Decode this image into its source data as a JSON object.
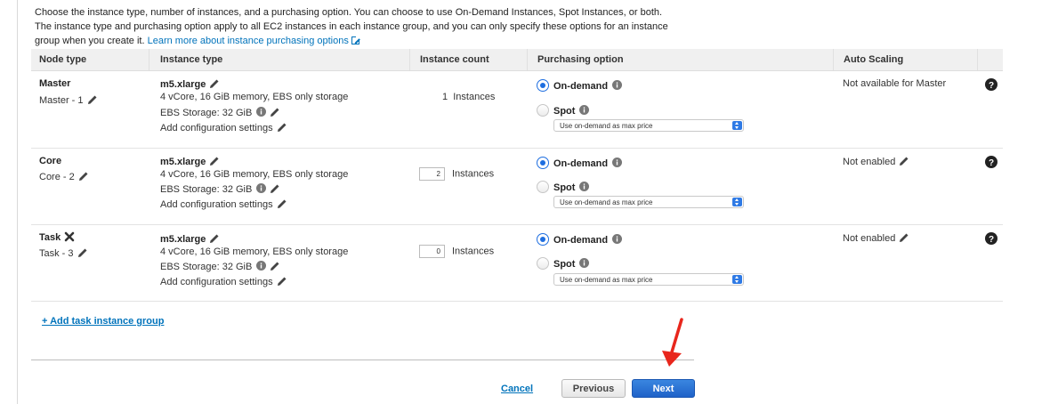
{
  "intro": {
    "line1": "Choose the instance type, number of instances, and a purchasing option. You can choose to use On-Demand Instances, Spot Instances, or both.",
    "line2": "The instance type and purchasing option apply to all EC2 instances in each instance group, and you can only specify these options for an instance",
    "line3": "group when you create it.",
    "link": "Learn more about instance purchasing options"
  },
  "table": {
    "headers": {
      "node_type": "Node type",
      "instance_type": "Instance type",
      "instance_count": "Instance count",
      "purchasing_option": "Purchasing option",
      "auto_scaling": "Auto Scaling"
    },
    "rows": [
      {
        "node": "Master",
        "group": "Master - 1",
        "type": "m5.xlarge",
        "spec": "4 vCore, 16 GiB memory, EBS only storage",
        "ebs": "EBS Storage:  32 GiB",
        "config": "Add configuration settings",
        "count": "1",
        "count_unit": "Instances",
        "on_demand": "On-demand",
        "spot": "Spot",
        "price": "Use on-demand as max price",
        "autoscaling": "Not available for Master"
      },
      {
        "node": "Core",
        "group": "Core - 2",
        "type": "m5.xlarge",
        "spec": "4 vCore, 16 GiB memory, EBS only storage",
        "ebs": "EBS Storage:  32 GiB",
        "config": "Add configuration settings",
        "count": "2",
        "count_unit": "Instances",
        "on_demand": "On-demand",
        "spot": "Spot",
        "price": "Use on-demand as max price",
        "autoscaling": "Not enabled"
      },
      {
        "node": "Task",
        "group": "Task - 3",
        "type": "m5.xlarge",
        "spec": "4 vCore, 16 GiB memory, EBS only storage",
        "ebs": "EBS Storage:  32 GiB",
        "config": "Add configuration settings",
        "count": "0",
        "count_unit": "Instances",
        "on_demand": "On-demand",
        "spot": "Spot",
        "price": "Use on-demand as max price",
        "autoscaling": "Not enabled"
      }
    ]
  },
  "add_group": "+ Add task instance group",
  "footer": {
    "cancel": "Cancel",
    "previous": "Previous",
    "next": "Next"
  },
  "colors": {
    "link": "#0073bb",
    "primary": "#1f62c8",
    "annotation_arrow": "#e8261c"
  }
}
